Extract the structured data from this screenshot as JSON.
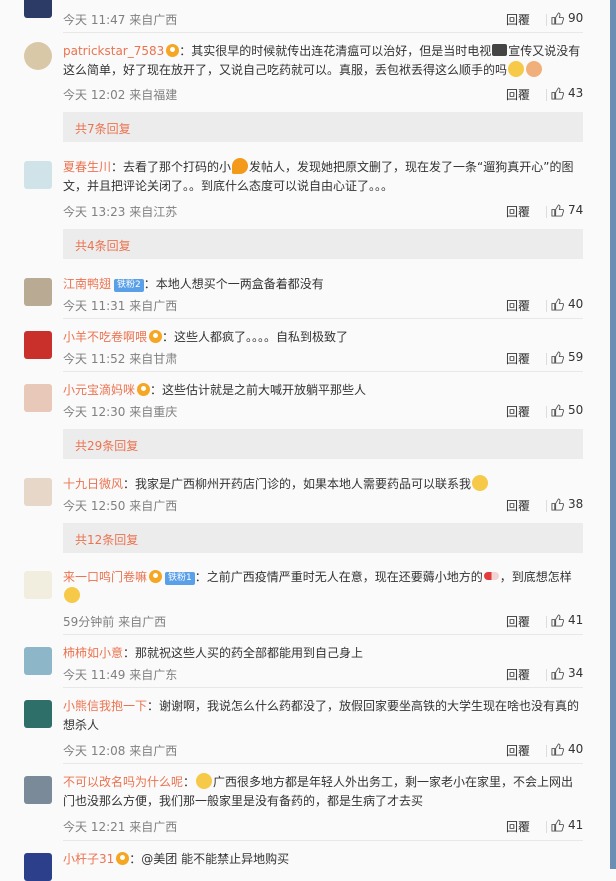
{
  "labels": {
    "reply": "回覆",
    "location_prefix": "来自"
  },
  "comments": [
    {
      "username": "",
      "text": "",
      "time": "今天 11:47",
      "location": "广西",
      "likes": "90"
    },
    {
      "username": "patrickstar_7583",
      "text": "：其实很早的时候就传出连花清瘟可以治好，但是当时电视",
      "text2": "宣传又说没有这么简单，好了现在放开了，又说自己吃药就可以。真服，丢包袱丢得这么顺手的吗",
      "time": "今天 12:02",
      "location": "福建",
      "likes": "43"
    },
    {
      "username": "夏春生川",
      "text": "：去看了那个打码的小",
      "text2": "发帖人，发现她把原文删了，现在发了一条“遛狗真开心”的图文，并且把评论关闭了。。到底什么态度可以说自由心证了。。。",
      "time": "今天 13:23",
      "location": "江苏",
      "likes": "74"
    },
    {
      "username": "江南鸭翅",
      "fan": "铁粉2",
      "text": "：本地人想买个一两盒备着都没有",
      "time": "今天 11:31",
      "location": "广西",
      "likes": "40"
    },
    {
      "username": "小羊不吃卷啊喂",
      "text": "：这些人都疯了。。。。自私到极致了",
      "time": "今天 11:52",
      "location": "甘肃",
      "likes": "59"
    },
    {
      "username": "小元宝滴妈咪",
      "text": "：这些估计就是之前大喊开放躺平那些人",
      "time": "今天 12:30",
      "location": "重庆",
      "likes": "50"
    },
    {
      "username": "十九日微风",
      "text": "：我家是广西柳州开药店门诊的，如果本地人需要药品可以联系我",
      "time": "今天 12:50",
      "location": "广西",
      "likes": "38"
    },
    {
      "username": "来一口鸣门卷嘛",
      "fan": "铁粉1",
      "text": "：之前广西疫情严重时无人在意，现在还要薅小地方的",
      "text2": "，到底想怎样",
      "time": "59分钟前",
      "location": "广西",
      "likes": "41"
    },
    {
      "username": "柿柿如小意",
      "text": "：那就祝这些人买的药全部都能用到自己身上",
      "time": "今天 11:49",
      "location": "广东",
      "likes": "34"
    },
    {
      "username": "小熊信我抱一下",
      "text": "：谢谢啊，我说怎么什么药都没了，放假回家要坐高铁的大学生现在啥也没有真的想杀人",
      "time": "今天 12:08",
      "location": "广西",
      "likes": "40"
    },
    {
      "username": "不可以改名吗为什么呢",
      "text": "：",
      "text2": "广西很多地方都是年轻人外出务工，剩一家老小在家里，不会上网出门也没那么方便，我们那一般家里是没有备药的，都是生病了才去买",
      "time": "今天 12:21",
      "location": "广西",
      "likes": "41"
    },
    {
      "username": "小杆子31",
      "text": "：@美团 能不能禁止异地购买"
    }
  ],
  "more_replies": [
    "共7条回复",
    "共4条回复",
    "共29条回复",
    "共12条回复"
  ],
  "colors": {
    "accent": "#eb7350",
    "text": "#333333",
    "meta": "#808080"
  }
}
